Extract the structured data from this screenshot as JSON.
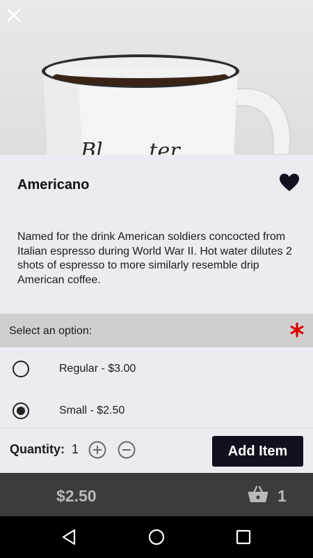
{
  "product": {
    "name": "Americano",
    "description": "Named for the drink American soldiers concocted from Italian espresso during World War II. Hot water dilutes 2 shots of espresso to more similarly resemble drip American coffee.",
    "image_icon": "coffee-mug-photo",
    "mug_text": "Bl... ...ter",
    "favorited": true
  },
  "options": {
    "header": "Select an option:",
    "required_icon": "asterisk-icon",
    "items": [
      {
        "label": "Regular - $3.00",
        "selected": false
      },
      {
        "label": "Small - $2.50",
        "selected": true
      }
    ]
  },
  "quantity": {
    "label": "Quantity:",
    "value": "1"
  },
  "add_button": {
    "label": "Add Item"
  },
  "cart": {
    "total": "$2.50",
    "count": "1"
  },
  "colors": {
    "accent_dark": "#10101e",
    "required_red": "#e00000",
    "cart_bar_bg": "#3c3c3c",
    "page_bg": "#ecebf1"
  }
}
